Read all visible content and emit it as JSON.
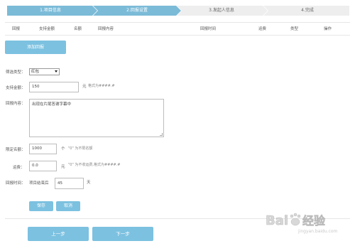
{
  "steps": [
    {
      "label": "1.项目信息",
      "active": true
    },
    {
      "label": "2.回报设置",
      "active": true
    },
    {
      "label": "3.发起人信息",
      "active": false
    },
    {
      "label": "4.完成",
      "active": false
    }
  ],
  "table_headers": [
    "回报",
    "支持金额",
    "名额",
    "回报内容",
    "回报时间",
    "运费",
    "类型",
    "操作"
  ],
  "add_button": "添加回报",
  "form": {
    "filter_label": "筛选类型：",
    "filter_value": "红包",
    "amount_label": "支持金额：",
    "amount_value": "150",
    "amount_unit": "元",
    "amount_hint": "格式为####.#",
    "content_label": "回报内容：",
    "content_value": "出现在片尾答谢字幕中",
    "quota_label": "限定名额：",
    "quota_value": "1000",
    "quota_unit": "个",
    "quota_hint": "\"0\" 为不限名额",
    "freight_label": "运费：",
    "freight_value": "0.0",
    "freight_unit": "元",
    "freight_hint": "\"0\" 为不收运费,格式为####.#",
    "time_label": "回报时间：",
    "time_prefix": "项目结束后",
    "time_value": "45",
    "time_unit": "天"
  },
  "save_button": "保存",
  "cancel_button": "取消",
  "prev_button": "上一步",
  "next_button": "下一步",
  "watermark": {
    "text": "Bai 经验",
    "sub": "jingyan.baidu.com"
  },
  "colors": {
    "accent": "#7cc1e0",
    "step_active": "#7bbbd8",
    "step_inactive": "#eeeeee"
  }
}
